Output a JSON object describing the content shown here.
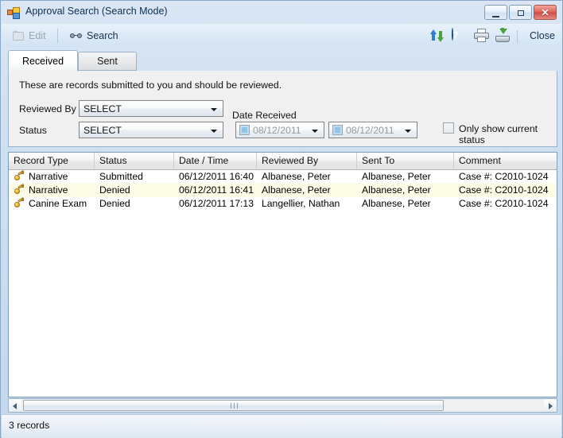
{
  "window": {
    "title": "Approval Search (Search Mode)",
    "app_icon": "application-window-icon",
    "minimize_label": "–",
    "maximize_label": "□",
    "close_label": "✕"
  },
  "toolbar": {
    "edit_label": "Edit",
    "search_label": "Search",
    "close_label": "Close",
    "icons": {
      "sort": "sort-ascending-icon",
      "help": "help-icon",
      "help_glyph": "?",
      "print": "printer-icon",
      "export": "export-download-icon"
    }
  },
  "tabs": [
    {
      "label": "Received",
      "active": true
    },
    {
      "label": "Sent",
      "active": false
    }
  ],
  "panel": {
    "description": "These are records submitted to you and should be reviewed.",
    "reviewed_by_label": "Reviewed By",
    "reviewed_by_value": "SELECT",
    "status_label": "Status",
    "status_value": "SELECT",
    "date_received_label": "Date Received",
    "date_from_value": "08/12/2011",
    "date_to_value": "08/12/2011",
    "only_current_status_label": "Only show current status",
    "only_current_status_checked": false
  },
  "grid": {
    "columns": [
      "Record Type",
      "Status",
      "Date / Time",
      "Reviewed By",
      "Sent To",
      "Comment"
    ],
    "rows": [
      {
        "record_type": "Narrative",
        "status": "Submitted",
        "datetime": "06/12/2011 16:40",
        "reviewed_by": "Albanese, Peter",
        "sent_to": "Albanese, Peter",
        "comment": "Case #: C2010-1024",
        "highlighted": false
      },
      {
        "record_type": "Narrative",
        "status": "Denied",
        "datetime": "06/12/2011 16:41",
        "reviewed_by": "Albanese, Peter",
        "sent_to": "Albanese, Peter",
        "comment": "Case #: C2010-1024",
        "highlighted": true
      },
      {
        "record_type": "Canine Exam",
        "status": "Denied",
        "datetime": "06/12/2011 17:13",
        "reviewed_by": "Langellier, Nathan",
        "sent_to": "Albanese, Peter",
        "comment": "Case #: C2010-1024",
        "highlighted": false
      }
    ]
  },
  "scrollbar": {
    "left_arrow": "scroll-left-arrow",
    "right_arrow": "scroll-right-arrow"
  },
  "statusbar": {
    "records_text": "3 records"
  },
  "colors": {
    "titlebar_accent": "#c4d8ec",
    "panel_bg": "#f0f0f0",
    "row_highlight": "#fdfde7",
    "close_button": "#cc4b43"
  }
}
